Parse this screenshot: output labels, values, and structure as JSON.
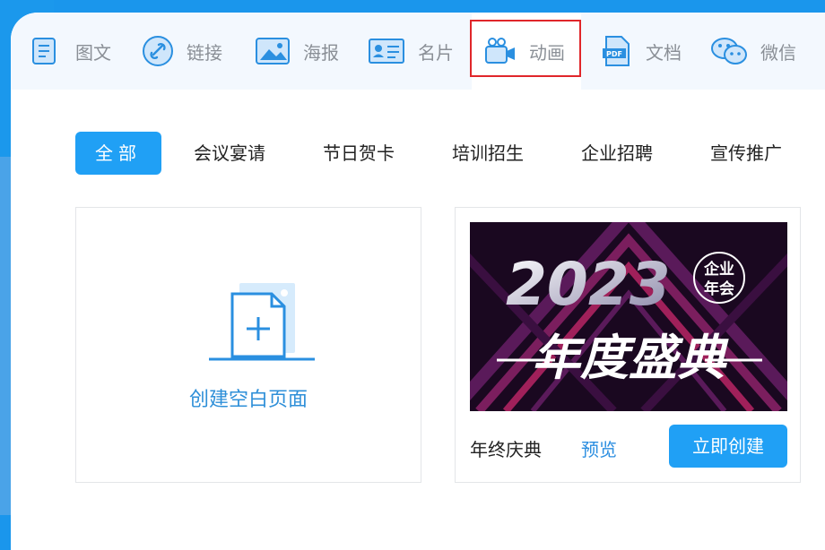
{
  "nav_tabs": [
    {
      "label": "图文",
      "icon": "document-icon"
    },
    {
      "label": "链接",
      "icon": "link-icon"
    },
    {
      "label": "海报",
      "icon": "image-icon"
    },
    {
      "label": "名片",
      "icon": "card-icon"
    },
    {
      "label": "动画",
      "icon": "video-camera-icon",
      "active": true
    },
    {
      "label": "文档",
      "icon": "pdf-icon"
    },
    {
      "label": "微信",
      "icon": "wechat-icon"
    }
  ],
  "categories": [
    "全部",
    "会议宴请",
    "节日贺卡",
    "培训招生",
    "企业招聘",
    "宣传推广"
  ],
  "blank_page": {
    "label": "创建空白页面"
  },
  "template": {
    "poster_year": "2023",
    "poster_badge_top": "企业",
    "poster_badge_bottom": "年会",
    "poster_title": "年度盛典",
    "name": "年终庆典",
    "preview": "预览",
    "create": "立即创建"
  },
  "colors": {
    "accent": "#20a0f5",
    "highlight": "#e0262a",
    "link": "#2b8ee0"
  }
}
